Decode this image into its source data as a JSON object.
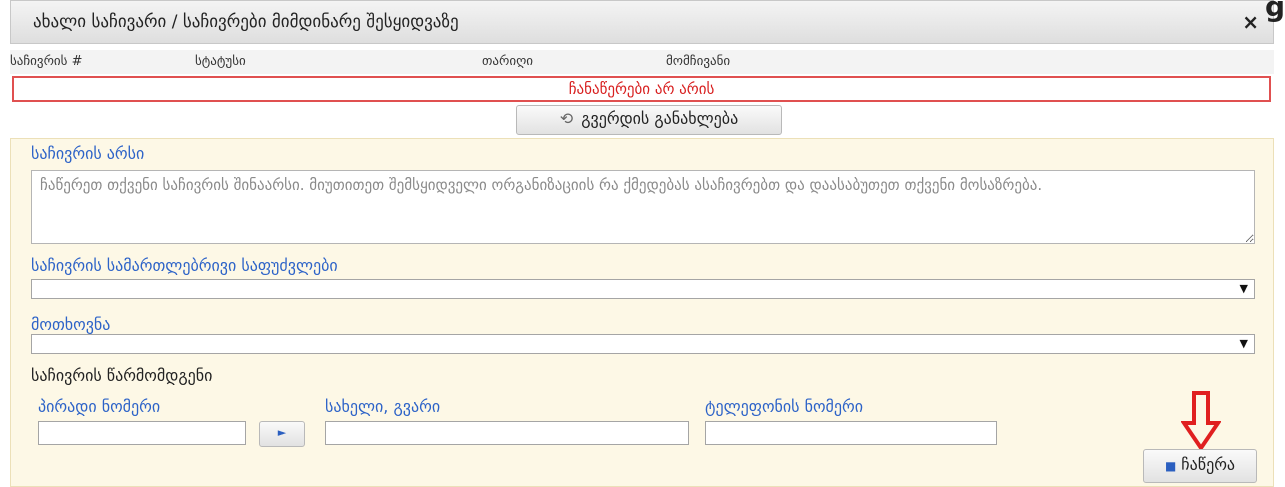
{
  "window": {
    "title": "ახალი საჩივარი / საჩივრები მიმდინარე შესყიდვაზე",
    "close_glyph": "×",
    "corner_glyph": "g"
  },
  "table": {
    "columns": [
      "საჩივრის #",
      "სტატუსი",
      "თარიღი",
      "მომჩივანი"
    ],
    "empty_message": "ჩანაწერები არ არის"
  },
  "refresh": {
    "icon": "refresh-icon",
    "glyph": "⟲",
    "label": "გვერდის განახლება"
  },
  "form": {
    "essence_label": "საჩივრის არსი",
    "essence_placeholder": "ჩაწერეთ თქვენი საჩივრის შინაარსი. მიუთითეთ შემსყიდველი ორგანიზაციის რა ქმედებას ასაჩივრებთ და დაასაბუთეთ თქვენი მოსაზრება.",
    "legal_basis_label": "საჩივრის სამართლებრივი საფუძვლები",
    "legal_basis_value": "",
    "request_label": "მოთხოვნა",
    "request_value": "",
    "representative_label": "საჩივრის წარმომდგენი",
    "personal_number_label": "პირადი ნომერი",
    "personal_number_value": "",
    "lookup_glyph": "►",
    "name_label": "სახელი, გვარი",
    "name_value": "",
    "phone_label": "ტელეფონის ნომერი",
    "phone_value": "",
    "dropdown_arrow": "▼",
    "save_label": "ჩაწერა",
    "save_glyph": "■"
  },
  "colors": {
    "accent": "#2d63c8",
    "error": "#d82020",
    "panel_bg": "#fdf8e6",
    "annotation_arrow": "#e02020"
  }
}
